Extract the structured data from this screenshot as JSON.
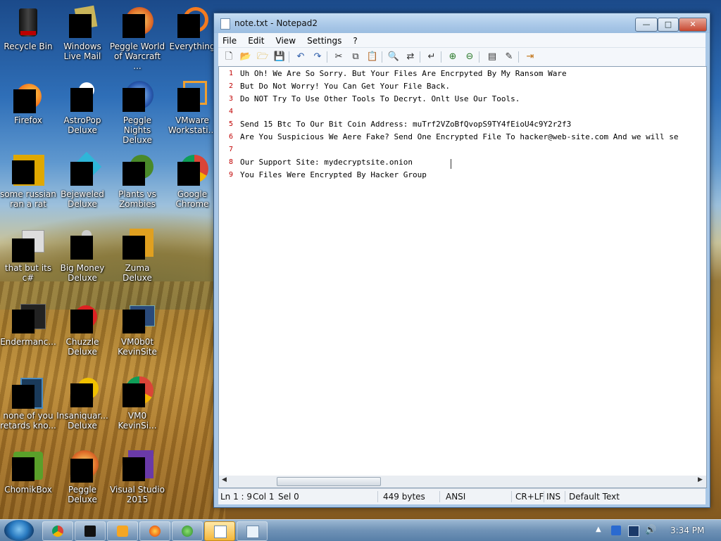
{
  "desktop": {
    "icons": [
      {
        "label": "Recycle Bin",
        "name": "recycle-bin-icon"
      },
      {
        "label": "Windows Live Mail",
        "name": "windows-live-mail-icon"
      },
      {
        "label": "Peggle World of Warcraft ...",
        "name": "peggle-wow-icon"
      },
      {
        "label": "Everything",
        "name": "everything-icon"
      },
      {
        "label": "Firefox",
        "name": "firefox-icon"
      },
      {
        "label": "AstroPop Deluxe",
        "name": "astropop-icon"
      },
      {
        "label": "Peggle Nights Deluxe",
        "name": "peggle-nights-icon"
      },
      {
        "label": "VMware Workstati...",
        "name": "vmware-icon"
      },
      {
        "label": "some russian ran a rat",
        "name": "file-icon"
      },
      {
        "label": "Bejeweled Deluxe",
        "name": "bejeweled-icon"
      },
      {
        "label": "Plants vs Zombies",
        "name": "plants-vs-zombies-icon"
      },
      {
        "label": "Google Chrome",
        "name": "chrome-icon"
      },
      {
        "label": "that but its c#",
        "name": "folder-icon"
      },
      {
        "label": "Big Money Deluxe",
        "name": "big-money-icon"
      },
      {
        "label": "Zuma Deluxe",
        "name": "zuma-icon"
      },
      {
        "label": "Endermanc...",
        "name": "endermanch-icon"
      },
      {
        "label": "Chuzzle Deluxe",
        "name": "chuzzle-icon"
      },
      {
        "label": "VM0b0t KevinSite",
        "name": "vm0b0t-icon"
      },
      {
        "label": "none of you retards kno...",
        "name": "app-icon"
      },
      {
        "label": "Insaniquar... Deluxe",
        "name": "insaniquarium-icon"
      },
      {
        "label": "VM0 KevinSi...",
        "name": "vm0-chrome-icon"
      },
      {
        "label": "ChomikBox",
        "name": "chomikbox-icon"
      },
      {
        "label": "Peggle Deluxe",
        "name": "peggle-deluxe-icon"
      },
      {
        "label": "Visual Studio 2015",
        "name": "visual-studio-icon"
      }
    ]
  },
  "window": {
    "title": "note.txt - Notepad2",
    "controls": {
      "minimize": "—",
      "maximize": "□",
      "close": "✕"
    },
    "menu": [
      "File",
      "Edit",
      "View",
      "Settings",
      "?"
    ],
    "line_numbers": [
      "1",
      "2",
      "3",
      "4",
      "5",
      "6",
      "7",
      "8",
      "9"
    ],
    "lines": [
      "Uh Oh! We Are So Sorry. But Your Files Are Encrpyted By My Ransom Ware",
      "But Do Not Worry! You Can Get Your File Back.",
      "Do NOT Try To Use Other Tools To Decryt. Onlt Use Our Tools.",
      "",
      "Send 15 Btc To Our Bit Coin Address: muTrf2VZoBfQvopS9TY4fEioU4c9Y2r2f3",
      "Are You Suspicious We Aere Fake? Send One Encrypted File To hacker@web-site.com And we will se",
      "",
      "Our Support Site: mydecryptsite.onion",
      "You Files Were Encrypted By Hacker Group"
    ],
    "status": {
      "position": "Ln 1 : 9",
      "column": "Col 1",
      "selection": "Sel 0",
      "size": "449 bytes",
      "encoding": "ANSI",
      "line_endings": "CR+LF",
      "mode": "INS",
      "scheme": "Default Text"
    }
  },
  "taskbar": {
    "clock": "3:34 PM",
    "buttons": [
      "chrome",
      "terminal",
      "media-player",
      "firefox",
      "network",
      "notepad2-active",
      "notepad"
    ]
  },
  "colors": {
    "line_number": "#c00000",
    "close_button": "#c7472f"
  }
}
